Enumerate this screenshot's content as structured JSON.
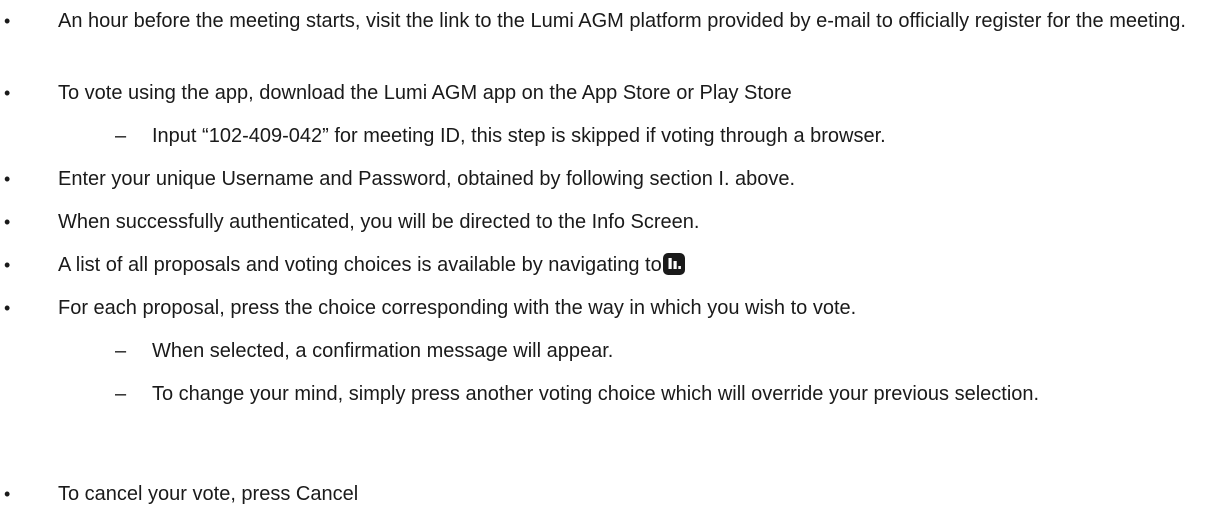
{
  "items": [
    {
      "text": "An hour before the meeting starts, visit the link to the Lumi AGM platform provided by e-mail to officially register for the meeting."
    },
    {
      "text": "To vote using the app, download the Lumi AGM app on the App Store or Play Store",
      "sub": [
        {
          "text": "Input “102-409-042” for meeting ID, this step is skipped if voting through a browser."
        }
      ]
    },
    {
      "text": "Enter your unique Username and Password, obtained by following section I. above."
    },
    {
      "text": "When successfully authenticated, you will be directed to the Info Screen."
    },
    {
      "text": "A list of all proposals and voting choices is available by navigating to",
      "icon": "results-icon"
    },
    {
      "text": "For each proposal, press the choice corresponding with the way in which you wish to vote.",
      "sub": [
        {
          "text": "When selected, a confirmation message will appear."
        },
        {
          "text": "To change your mind, simply press another voting choice which will override your previous selection."
        }
      ]
    },
    {
      "text": "To cancel your vote, press Cancel"
    }
  ],
  "bullet_glyph": "•",
  "dash_glyph": "–",
  "colors": {
    "text": "#1a1a1a",
    "icon_bg": "#1a1a1a",
    "icon_fg": "#ffffff"
  }
}
